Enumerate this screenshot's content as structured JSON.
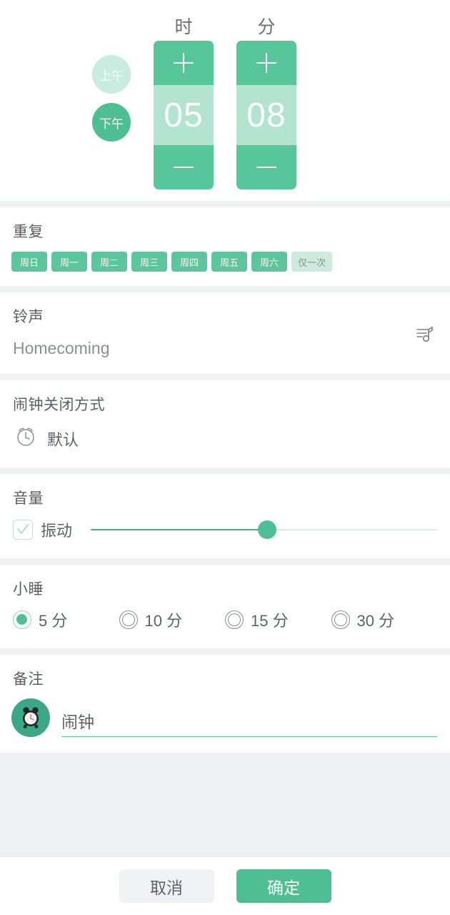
{
  "time_picker": {
    "hour_label": "时",
    "minute_label": "分",
    "am_label": "上午",
    "pm_label": "下午",
    "am_selected": false,
    "pm_selected": true,
    "hour_value": "05",
    "minute_value": "08",
    "increase_icon": "plus-icon",
    "decrease_icon": "minus-icon"
  },
  "repeat": {
    "title": "重复",
    "days": [
      {
        "label": "周日",
        "selected": true
      },
      {
        "label": "周一",
        "selected": true
      },
      {
        "label": "周二",
        "selected": true
      },
      {
        "label": "周三",
        "selected": true
      },
      {
        "label": "周四",
        "selected": true
      },
      {
        "label": "周五",
        "selected": true
      },
      {
        "label": "周六",
        "selected": true
      },
      {
        "label": "仅一次",
        "selected": false
      }
    ]
  },
  "ringtone": {
    "title": "铃声",
    "value": "Homecoming",
    "icon": "music-note-icon"
  },
  "dismiss": {
    "title": "闹钟关闭方式",
    "value": "默认",
    "icon": "alarm-clock-outline-icon"
  },
  "volume": {
    "title": "音量",
    "vibrate_label": "振动",
    "vibrate_checked": true,
    "checkbox_icon": "check-icon",
    "slider_percent": 51
  },
  "snooze": {
    "title": "小睡",
    "options": [
      {
        "label": "5 分",
        "selected": true
      },
      {
        "label": "10 分",
        "selected": false
      },
      {
        "label": "15 分",
        "selected": false
      },
      {
        "label": "30 分",
        "selected": false
      }
    ]
  },
  "note": {
    "title": "备注",
    "value": "闹钟",
    "placeholder": "闹钟",
    "avatar_icon": "alarm-clock-icon"
  },
  "footer": {
    "cancel_label": "取消",
    "confirm_label": "确定"
  },
  "colors": {
    "accent": "#4ebf92",
    "accent_light": "#b2e4d0",
    "chip_on": "#5cc59e",
    "chip_off": "#cdeade",
    "page_bg": "#eff1f5",
    "panel_bg": "#ffffff",
    "text": "#5e6369",
    "muted_text": "#8b9096"
  }
}
